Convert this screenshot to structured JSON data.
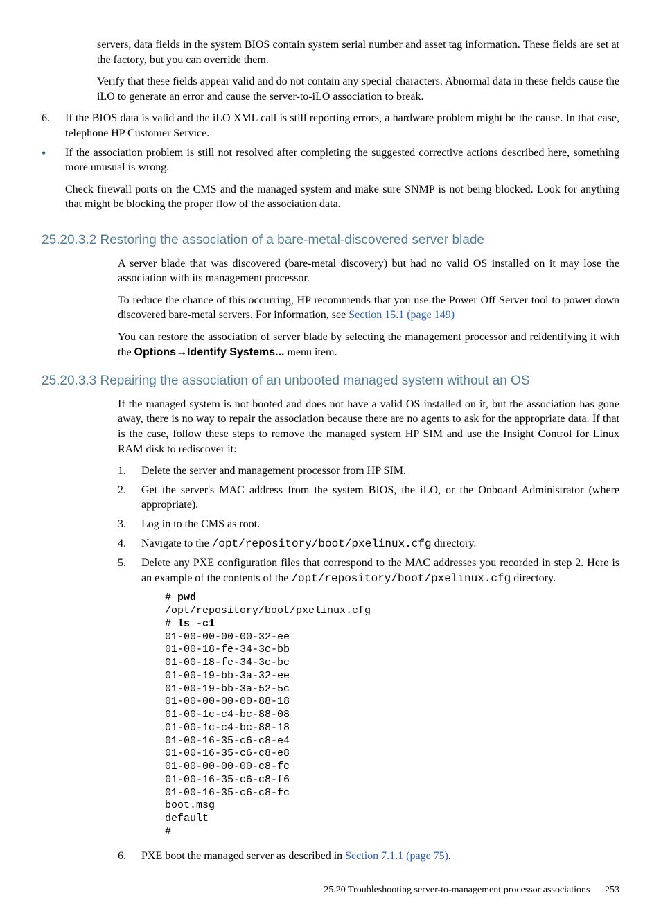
{
  "intro": {
    "p1": "servers, data fields in the system BIOS contain system serial number and asset tag information. These fields are set at the factory, but you can override them.",
    "p2": "Verify that these fields appear valid and do not contain any special characters. Abnormal data in these fields cause the iLO to generate an error and cause the server-to-iLO association to break.",
    "step6": "If the BIOS data is valid and the iLO XML call is still reporting errors, a hardware problem might be the cause. In that case, telephone HP Customer Service.",
    "bullet1": "If the association problem is still not resolved after completing the suggested corrective actions described here, something more unusual is wrong.",
    "bullet1b": "Check firewall ports on the CMS and the managed system and make sure SNMP is not being blocked. Look for anything that might be blocking the proper flow of the association data."
  },
  "sec2": {
    "heading": "25.20.3.2 Restoring the association of a bare-metal-discovered server blade",
    "p1": "A server blade that was discovered (bare-metal discovery) but had no valid OS installed on it may lose the association with its management processor.",
    "p2a": "To reduce the chance of this occurring, HP recommends that you use the Power Off Server tool to power down discovered bare-metal servers. For information, see ",
    "p2link": "Section 15.1 (page 149)",
    "p3a": "You can restore the association of server blade by selecting the management processor and reidentifying it with the ",
    "p3b": "Options",
    "p3c": "Identify Systems...",
    "p3d": " menu item."
  },
  "sec3": {
    "heading": "25.20.3.3 Repairing the association of an unbooted managed system without an OS",
    "p1": "If the managed system is not booted and does not have a valid OS installed on it, but the association has gone away, there is no way to repair the association because there are no agents to ask for the appropriate data. If that is the case, follow these steps to remove the managed system HP SIM and use the Insight Control for Linux RAM disk to rediscover it:",
    "steps": {
      "s1": "Delete the server and management processor from HP SIM.",
      "s2": "Get the server's MAC address from the system BIOS, the iLO, or the Onboard Administrator (where appropriate).",
      "s3": "Log in to the CMS as root.",
      "s4a": "Navigate to the ",
      "s4b": "/opt/repository/boot/pxelinux.cfg",
      "s4c": " directory.",
      "s5a": "Delete any PXE configuration files that correspond to the MAC addresses you recorded in step 2. Here is an example of the contents of the ",
      "s5b": "/opt/repository/boot/pxelinux.cfg",
      "s5c": " directory.",
      "s6a": "PXE boot the managed server as described in ",
      "s6link": "Section 7.1.1 (page 75)",
      "s6b": "."
    },
    "code": "# <b>pwd</b>\n/opt/repository/boot/pxelinux.cfg\n# <b>ls -c1</b>\n01-00-00-00-00-32-ee\n01-00-18-fe-34-3c-bb\n01-00-18-fe-34-3c-bc\n01-00-19-bb-3a-32-ee\n01-00-19-bb-3a-52-5c\n01-00-00-00-00-88-18\n01-00-1c-c4-bc-88-08\n01-00-1c-c4-bc-88-18\n01-00-16-35-c6-c8-e4\n01-00-16-35-c6-c8-e8\n01-00-00-00-00-c8-fc\n01-00-16-35-c6-c8-f6\n01-00-16-35-c6-c8-fc\nboot.msg\ndefault\n#"
  },
  "footer": {
    "section": "25.20 Troubleshooting server-to-management processor associations",
    "page": "253"
  }
}
